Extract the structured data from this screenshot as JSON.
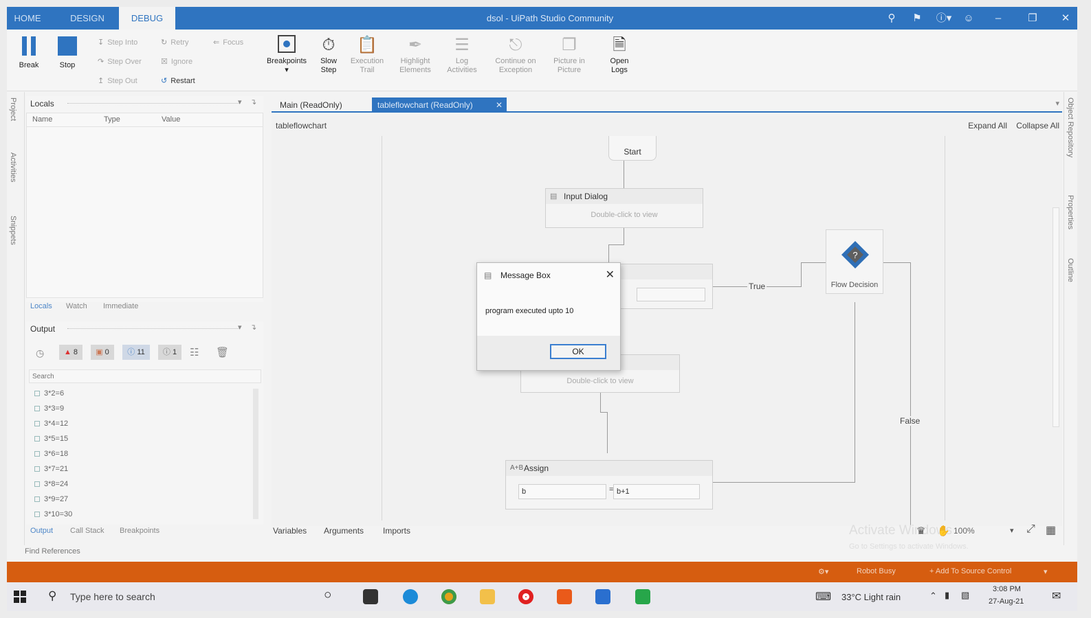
{
  "titlebar": {
    "tabs": [
      "HOME",
      "DESIGN",
      "DEBUG"
    ],
    "active_tab": "DEBUG",
    "title": "dsol - UiPath Studio Community"
  },
  "ribbon": {
    "break": "Break",
    "stop": "Stop",
    "step_into": "Step Into",
    "step_over": "Step Over",
    "step_out": "Step Out",
    "retry": "Retry",
    "ignore": "Ignore",
    "restart": "Restart",
    "focus": "Focus",
    "breakpoints": "Breakpoints",
    "slow_step": [
      "Slow",
      "Step"
    ],
    "execution_trail": [
      "Execution",
      "Trail"
    ],
    "highlight_elements": [
      "Highlight",
      "Elements"
    ],
    "log_activities": [
      "Log",
      "Activities"
    ],
    "continue_on_exception": [
      "Continue on",
      "Exception"
    ],
    "picture_in_picture": [
      "Picture in",
      "Picture"
    ],
    "open_logs": [
      "Open",
      "Logs"
    ]
  },
  "leftrail": {
    "items": [
      "Project",
      "Activities",
      "Snippets"
    ]
  },
  "locals": {
    "title": "Locals",
    "columns": [
      "Name",
      "Type",
      "Value"
    ],
    "tabs": [
      "Locals",
      "Watch",
      "Immediate"
    ]
  },
  "output": {
    "title": "Output",
    "filters": {
      "errors": "8",
      "warnings": "0",
      "info": "11",
      "trace": "1"
    },
    "search_placeholder": "Search",
    "lines": [
      "3*2=6",
      "3*3=9",
      "3*4=12",
      "3*5=15",
      "3*6=18",
      "3*7=21",
      "3*8=24",
      "3*9=27",
      "3*10=30"
    ],
    "tabs": [
      "Output",
      "Call Stack",
      "Breakpoints"
    ],
    "find_references": "Find References"
  },
  "designer": {
    "tabs": [
      "Main (ReadOnly)",
      "tableflowchart (ReadOnly)"
    ],
    "active_tab": "tableflowchart (ReadOnly)",
    "breadcrumb": "tableflowchart",
    "expand_all": "Expand All",
    "collapse_all": "Collapse All",
    "start": "Start",
    "input_dialog": {
      "title": "Input Dialog",
      "body": "Double-click to view"
    },
    "msg_activity_body": "Double-click to view",
    "flow_decision": "Flow Decision",
    "true_label": "True",
    "false_label": "False",
    "assign": {
      "title": "Assign",
      "left": "b",
      "right": "b+1"
    },
    "bottom_tabs": [
      "Variables",
      "Arguments",
      "Imports"
    ],
    "zoom": "100%",
    "activate_title": "Activate Windows",
    "activate_sub": "Go to Settings to activate Windows."
  },
  "message_box": {
    "title": "Message Box",
    "text": "program executed upto 10",
    "ok": "OK"
  },
  "right_rail": [
    "Object Repository",
    "Properties",
    "Outline"
  ],
  "statusbar": {
    "debug_state": "Robot Busy",
    "source_control": "+ Add To Source Control",
    "extra": "▾"
  },
  "taskbar": {
    "search_placeholder": "Type here to search",
    "weather": "33°C  Light rain",
    "time": "3:08 PM",
    "date": "27-Aug-21"
  },
  "colors": {
    "accent": "#2f74c0",
    "status_orange": "#d65d10"
  }
}
